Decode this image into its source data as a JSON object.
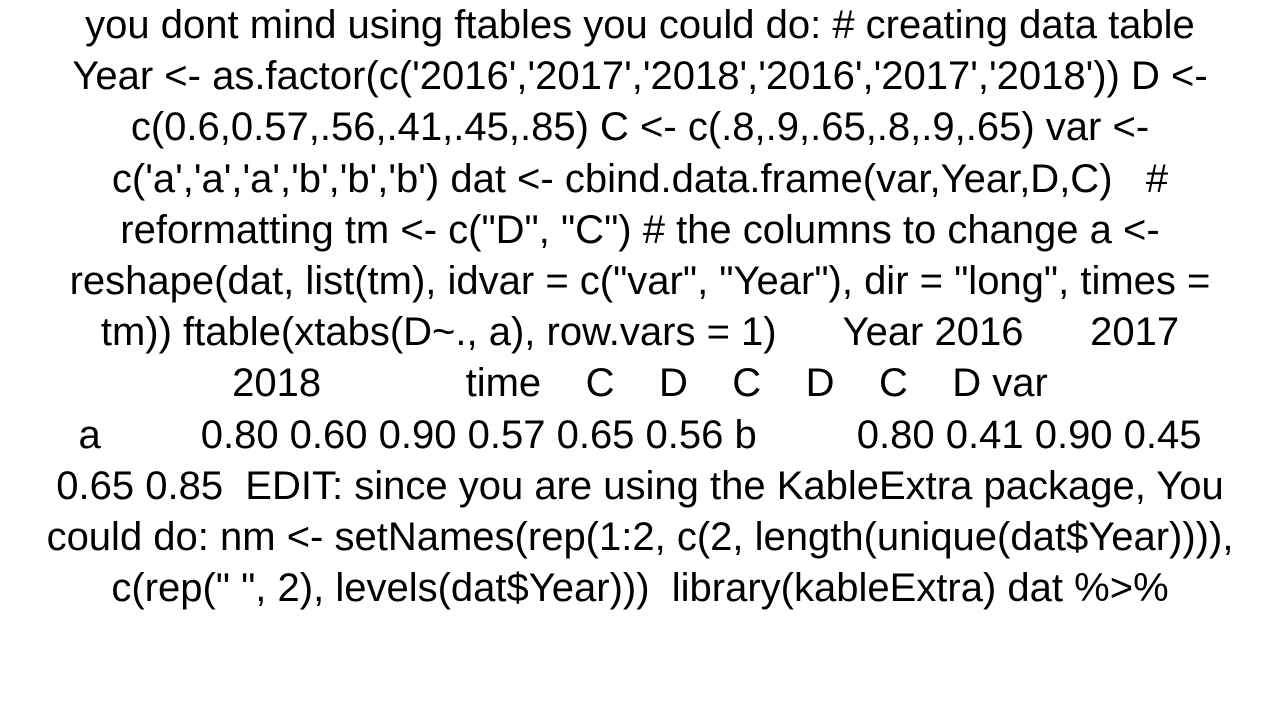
{
  "text": "you dont mind using ftables you could do: # creating data table Year <- as.factor(c('2016','2017','2018','2016','2017','2018')) D <- c(0.6,0.57,.56,.41,.45,.85) C <- c(.8,.9,.65,.8,.9,.65) var <- c('a','a','a','b','b','b') dat <- cbind.data.frame(var,Year,D,C)   # reformatting tm <- c(\"D\", \"C\") # the columns to change a <- reshape(dat, list(tm), idvar = c(\"var\", \"Year\"), dir = \"long\", times = tm)) ftable(xtabs(D~., a), row.vars = 1)      Year 2016      2017      2018             time    C    D    C    D    C    D var                                        a         0.80 0.60 0.90 0.57 0.65 0.56 b         0.80 0.41 0.90 0.45 0.65 0.85  EDIT: since you are using the KableExtra package, You could do: nm <- setNames(rep(1:2, c(2, length(unique(dat$Year)))), c(rep(\" \", 2), levels(dat$Year)))  library(kableExtra) dat %>%"
}
